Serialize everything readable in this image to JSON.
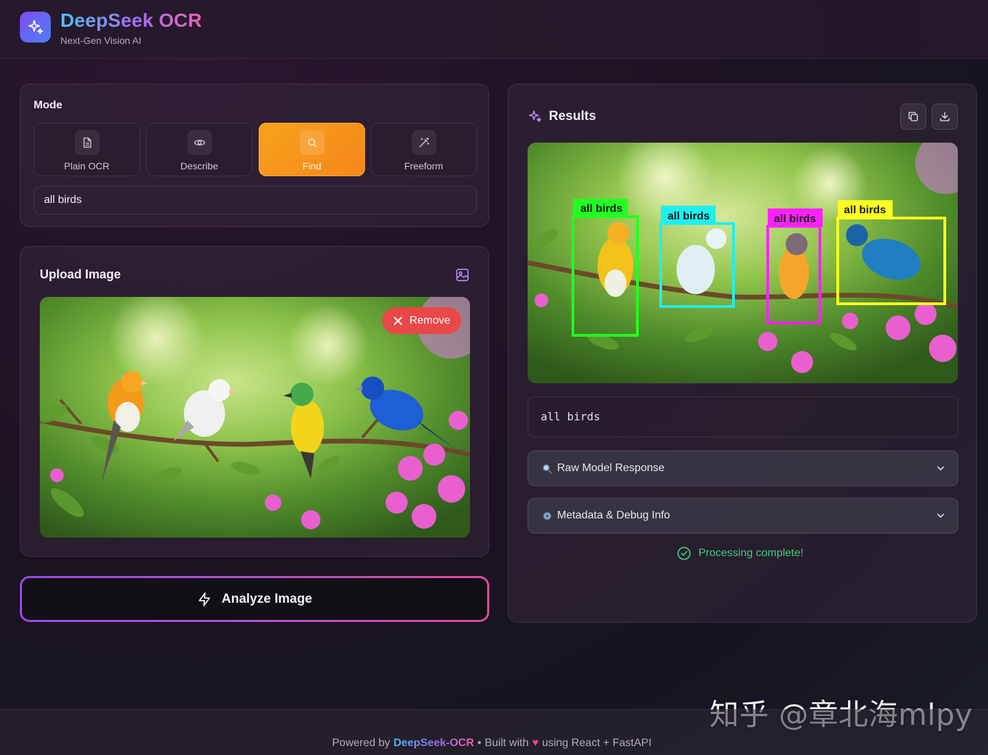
{
  "header": {
    "title": "DeepSeek OCR",
    "subtitle": "Next-Gen Vision AI",
    "logo_icon": "sparkles-icon"
  },
  "mode": {
    "label": "Mode",
    "options": [
      {
        "label": "Plain OCR",
        "icon": "document-icon",
        "active": false
      },
      {
        "label": "Describe",
        "icon": "eye-icon",
        "active": false
      },
      {
        "label": "Find",
        "icon": "search-icon",
        "active": true
      },
      {
        "label": "Freeform",
        "icon": "magic-wand-icon",
        "active": false
      }
    ],
    "prompt_value": "all birds",
    "active_color": "#f6951b"
  },
  "upload": {
    "title": "Upload Image",
    "remove_label": "Remove",
    "image_description_icon": "image-icon"
  },
  "analyze": {
    "label": "Analyze Image",
    "icon": "lightning-icon"
  },
  "results": {
    "title": "Results",
    "copy_icon": "copy-icon",
    "download_icon": "download-icon",
    "detections": [
      {
        "label": "all birds",
        "color": "#22ff22"
      },
      {
        "label": "all birds",
        "color": "#1ef0f0"
      },
      {
        "label": "all birds",
        "color": "#ff22ff"
      },
      {
        "label": "all birds",
        "color": "#ffff22"
      }
    ],
    "text_output": "all birds",
    "raw_response_label": "Raw Model Response",
    "metadata_label": "Metadata & Debug Info",
    "status": "Processing complete!",
    "status_color": "#3ecf7a"
  },
  "watermark": "知乎 @章北海mlpy",
  "footer": {
    "powered_by": "Powered by",
    "brand": "DeepSeek-OCR",
    "separator": "•",
    "built_with": "Built with",
    "heart": "♥",
    "using": "using React + FastAPI"
  }
}
